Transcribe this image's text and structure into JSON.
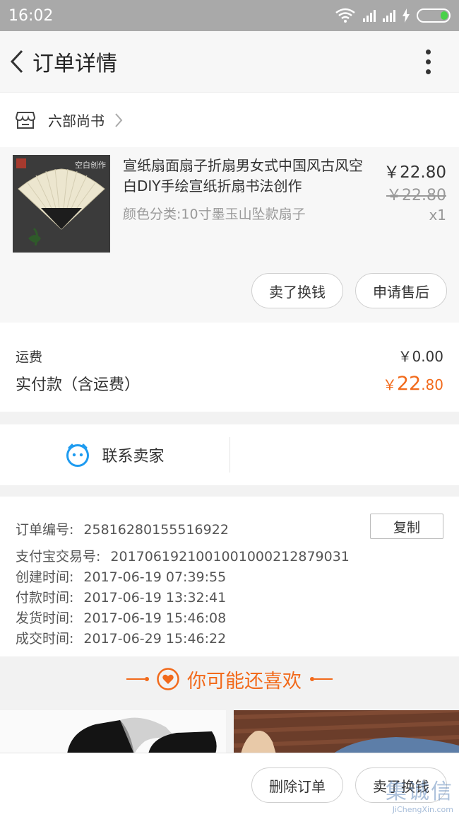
{
  "status_bar": {
    "time": "16:02"
  },
  "nav": {
    "title": "订单详情"
  },
  "shop": {
    "name": "六部尚书"
  },
  "product": {
    "title": "宣纸扇面扇子折扇男女式中国风古风空白DIY手绘宣纸折扇书法创作",
    "image_text": "空白创作",
    "spec": "颜色分类:10寸墨玉山坠款扇子",
    "price": "￥22.80",
    "original_price": "￥22.80",
    "quantity": "x1",
    "btn_resell": "卖了换钱",
    "btn_after_sale": "申请售后"
  },
  "fees": {
    "shipping_label": "运费",
    "shipping_value": "￥0.00",
    "paid_label": "实付款（含运费）",
    "paid_symbol": "￥",
    "paid_int": "22",
    "paid_dec": ".80"
  },
  "contact": {
    "label": "联系卖家"
  },
  "order_info": {
    "copy_label": "复制",
    "rows": [
      {
        "key": "订单编号:",
        "value": "25816280155516922"
      },
      {
        "key": "支付宝交易号:",
        "value": "2017061921001001000212879031"
      },
      {
        "key": "创建时间:",
        "value": "2017-06-19 07:39:55"
      },
      {
        "key": "付款时间:",
        "value": "2017-06-19 13:32:41"
      },
      {
        "key": "发货时间:",
        "value": "2017-06-19 15:46:08"
      },
      {
        "key": "成交时间:",
        "value": "2017-06-29 15:46:22"
      }
    ]
  },
  "recommend": {
    "title": "你可能还喜欢"
  },
  "bottom": {
    "btn_delete": "删除订单",
    "btn_resell": "卖了换钱"
  },
  "watermark": {
    "text": "集诚信",
    "sub": "JiChengXin.com"
  },
  "colors": {
    "accent": "#f26a1b",
    "contact_icon": "#1e9bf0"
  }
}
